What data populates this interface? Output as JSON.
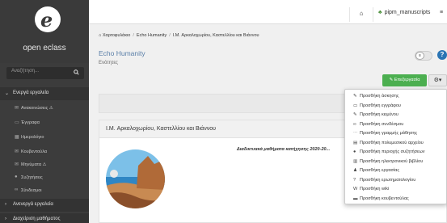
{
  "sidebar": {
    "logo_text": "open eclass",
    "search_placeholder": "Αναζήτηση...",
    "group_active": "Ενεργά εργαλεία",
    "items": [
      {
        "label": "Ανακοινώσεις ⚠",
        "icon": "megaphone-icon",
        "glyph": "✉"
      },
      {
        "label": "Έγγραφα",
        "icon": "folder-icon",
        "glyph": "▭"
      },
      {
        "label": "Ημερολόγιο",
        "icon": "calendar-icon",
        "glyph": "▦"
      },
      {
        "label": "Κουβεντούλα",
        "icon": "chat-icon",
        "glyph": "✉"
      },
      {
        "label": "Μηνύματα ⚠",
        "icon": "envelope-icon",
        "glyph": "✉"
      },
      {
        "label": "Συζητήσεις",
        "icon": "comments-icon",
        "glyph": "●"
      },
      {
        "label": "Σύνδεσμοι",
        "icon": "link-icon",
        "glyph": "∞"
      }
    ],
    "group_inactive": "Ανενεργά εργαλεία",
    "group_admin": "Διαχείριση μαθήματος"
  },
  "topbar": {
    "home_glyph": "⌂",
    "user_name": "pipm_manuscripts",
    "extra": "≡"
  },
  "breadcrumb": [
    "Χαρτοφυλάκιο",
    "Echo Humanity",
    "I.M. Αρκαλοχωρίου, Καστελλίου και Βιάννου"
  ],
  "course": {
    "title": "Echo Humanity",
    "subtitle": "Ενότητες"
  },
  "toolbar": {
    "edit_label": "Επεξεργασία",
    "edit_glyph": "✎",
    "gear_glyph": "⚙▾",
    "help_glyph": "?"
  },
  "card": {
    "title": "I.M. Αρκαλοχωρίου, Καστελλίου και Βιάννου",
    "description": "Διαδικτυακά μαθήματα κατήχησης 2020-20..."
  },
  "dropdown": [
    {
      "label": "Προσθήκη άσκησης",
      "icon": "pencil-square-icon",
      "glyph": "✎"
    },
    {
      "label": "Προσθήκη εγγράφου",
      "icon": "folder-open-icon",
      "glyph": "▭"
    },
    {
      "label": "Προσθήκη κειμένου",
      "icon": "pencil-icon",
      "glyph": "✎"
    },
    {
      "label": "Προσθήκη συνδέσμου",
      "icon": "link-icon",
      "glyph": "∞"
    },
    {
      "label": "Προσθήκη γραμμής μάθησης",
      "icon": "ellipsis-icon",
      "glyph": "⋯"
    },
    {
      "label": "Προσθήκη πολυμεσικού αρχείου",
      "icon": "film-icon",
      "glyph": "▤"
    },
    {
      "label": "Προσθήκη περιοχής συζητήσεων",
      "icon": "comments-icon",
      "glyph": "●"
    },
    {
      "label": "Προσθήκη ηλεκτρονικού βιβλίου",
      "icon": "book-icon",
      "glyph": "▥"
    },
    {
      "label": "Προσθήκη εργασίας",
      "icon": "user-icon",
      "glyph": "♟"
    },
    {
      "label": "Προσθήκη ερωτηματολογίου",
      "icon": "question-circle-icon",
      "glyph": "?"
    },
    {
      "label": "Προσθήκη wiki",
      "icon": "wikipedia-icon",
      "glyph": "W"
    },
    {
      "label": "Προσθήκη κουβεντούλας",
      "icon": "chat-icon",
      "glyph": "▬"
    }
  ],
  "colors": {
    "sidebar_bg": "#3c3c3c",
    "accent_green": "#4caf50",
    "link_blue": "#5a7fa8",
    "help_blue": "#2a74b4"
  }
}
